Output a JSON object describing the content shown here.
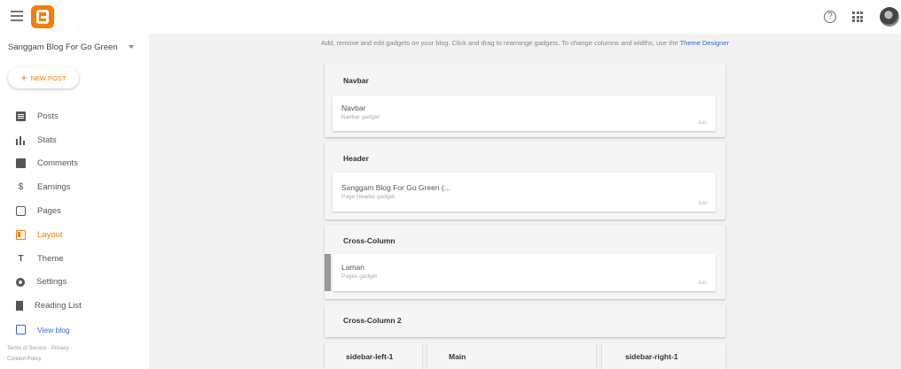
{
  "header": {
    "menu_icon": "hamburger-icon",
    "logo_icon": "blogger-logo-icon",
    "help_icon": "help-icon",
    "apps_icon": "apps-grid-icon",
    "brand_color": "#f57d00"
  },
  "sidebar": {
    "blog_name": "Sanggam Blog For Go Green",
    "new_post_label": "NEW POST",
    "items": [
      {
        "label": "Posts",
        "icon": "posts-icon"
      },
      {
        "label": "Stats",
        "icon": "stats-icon"
      },
      {
        "label": "Comments",
        "icon": "comments-icon"
      },
      {
        "label": "Earnings",
        "icon": "dollar-icon"
      },
      {
        "label": "Pages",
        "icon": "pages-icon"
      },
      {
        "label": "Layout",
        "icon": "layout-icon",
        "active": true
      },
      {
        "label": "Theme",
        "icon": "theme-icon"
      },
      {
        "label": "Settings",
        "icon": "gear-icon"
      },
      {
        "label": "Reading List",
        "icon": "bookmark-icon"
      },
      {
        "label": "View blog",
        "icon": "external-link-icon"
      }
    ],
    "footer": {
      "terms": "Terms of Service",
      "privacy": "Privacy",
      "content_policy": "Content Policy"
    }
  },
  "main": {
    "instructions": "Add, remove and edit gadgets on your blog. Click and drag to rearrange gadgets. To change columns and widths, use the",
    "theme_designer_link": "Theme Designer",
    "sections": [
      {
        "title": "Navbar",
        "gadget": {
          "name": "Navbar",
          "type": "Navbar gadget",
          "edit": "Edit"
        }
      },
      {
        "title": "Header",
        "gadget": {
          "name": "Sanggam Blog For Go Green (...",
          "type": "Page Header gadget",
          "edit": "Edit"
        }
      },
      {
        "title": "Cross-Column",
        "gadget": {
          "name": "Laman",
          "type": "Pages gadget",
          "edit": "Edit"
        }
      },
      {
        "title": "Cross-Column 2"
      }
    ],
    "columns": [
      {
        "title": "sidebar-left-1"
      },
      {
        "title": "Main"
      },
      {
        "title": "sidebar-right-1"
      }
    ]
  }
}
